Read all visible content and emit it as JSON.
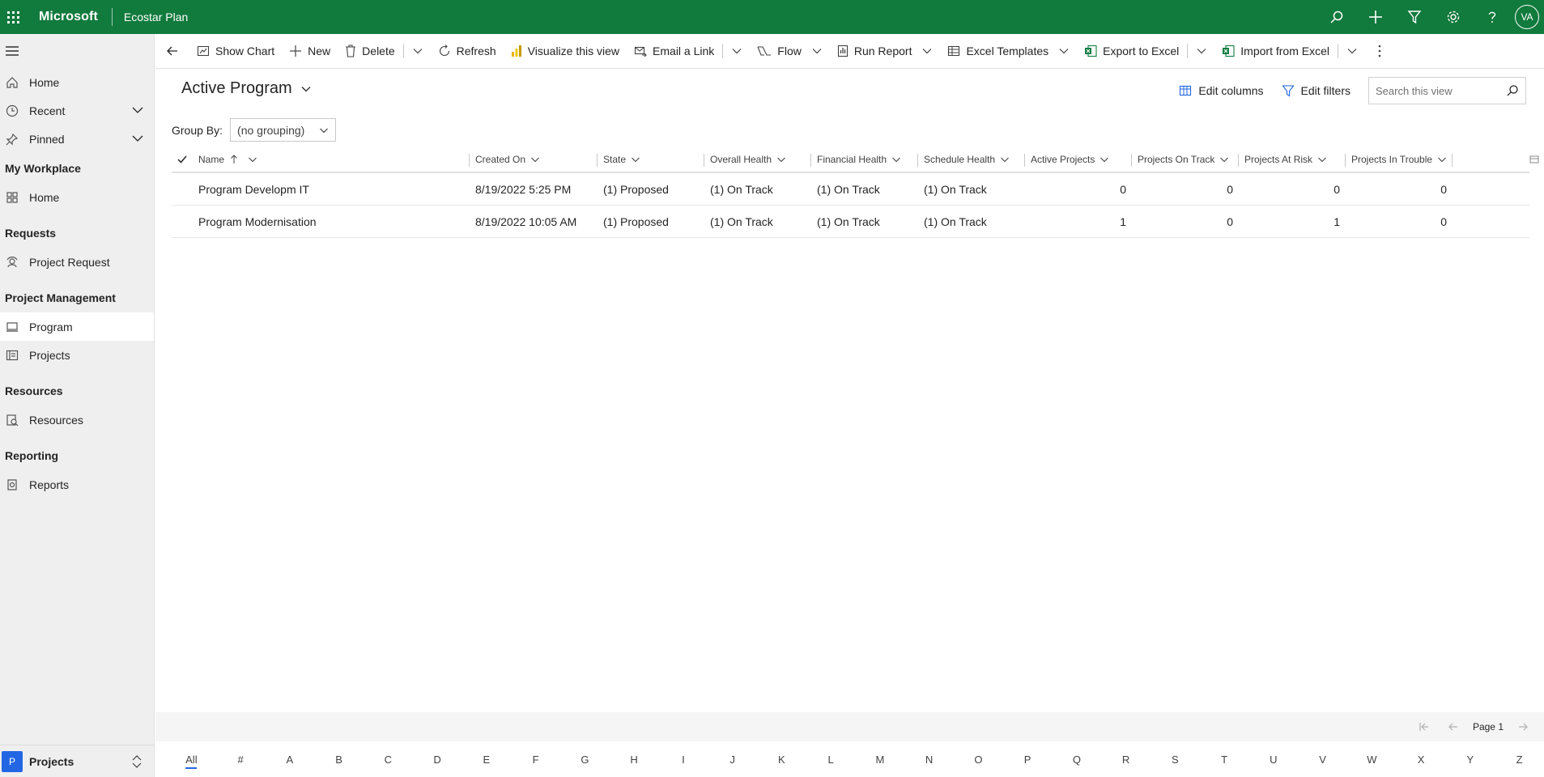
{
  "topbar": {
    "brand": "Microsoft",
    "app_name": "Ecostar Plan",
    "avatar_initials": "VA",
    "bg_color": "#117a3d"
  },
  "sidebar": {
    "top_items": [
      {
        "label": "Home",
        "icon": "home-icon"
      },
      {
        "label": "Recent",
        "icon": "clock-icon"
      },
      {
        "label": "Pinned",
        "icon": "pin-icon"
      }
    ],
    "groups": [
      {
        "title": "My Workplace",
        "items": [
          {
            "label": "Home",
            "icon": "workplace-home-icon"
          }
        ]
      },
      {
        "title": "Requests",
        "items": [
          {
            "label": "Project Request",
            "icon": "request-icon"
          }
        ]
      },
      {
        "title": "Project Management",
        "items": [
          {
            "label": "Program",
            "icon": "program-icon",
            "active": true
          },
          {
            "label": "Projects",
            "icon": "projects-icon"
          }
        ]
      },
      {
        "title": "Resources",
        "items": [
          {
            "label": "Resources",
            "icon": "resources-icon"
          }
        ]
      },
      {
        "title": "Reporting",
        "items": [
          {
            "label": "Reports",
            "icon": "reports-icon"
          }
        ]
      }
    ],
    "area": {
      "badge": "P",
      "label": "Projects"
    }
  },
  "commandbar": {
    "show_chart": "Show Chart",
    "new": "New",
    "delete": "Delete",
    "refresh": "Refresh",
    "visualize": "Visualize this view",
    "email_link": "Email a Link",
    "flow": "Flow",
    "run_report": "Run Report",
    "excel_templates": "Excel Templates",
    "export_excel": "Export to Excel",
    "import_excel": "Import from Excel"
  },
  "view": {
    "title": "Active Program",
    "edit_columns": "Edit columns",
    "edit_filters": "Edit filters",
    "search_placeholder": "Search this view",
    "group_by_label": "Group By:",
    "group_by_value": "(no grouping)"
  },
  "grid": {
    "columns": [
      "Name",
      "Created On",
      "State",
      "Overall Health",
      "Financial Health",
      "Schedule Health",
      "Active Projects",
      "Projects On Track",
      "Projects At Risk",
      "Projects In Trouble"
    ],
    "rows": [
      [
        "Program Developm IT",
        "8/19/2022 5:25 PM",
        "(1) Proposed",
        "(1) On Track",
        "(1) On Track",
        "(1) On Track",
        "0",
        "0",
        "0",
        "0"
      ],
      [
        "Program Modernisation",
        "8/19/2022 10:05 AM",
        "(1) Proposed",
        "(1) On Track",
        "(1) On Track",
        "(1) On Track",
        "1",
        "0",
        "1",
        "0"
      ]
    ]
  },
  "pager": {
    "label": "Page 1"
  },
  "alphabet": [
    "All",
    "#",
    "A",
    "B",
    "C",
    "D",
    "E",
    "F",
    "G",
    "H",
    "I",
    "J",
    "K",
    "L",
    "M",
    "N",
    "O",
    "P",
    "Q",
    "R",
    "S",
    "T",
    "U",
    "V",
    "W",
    "X",
    "Y",
    "Z"
  ]
}
